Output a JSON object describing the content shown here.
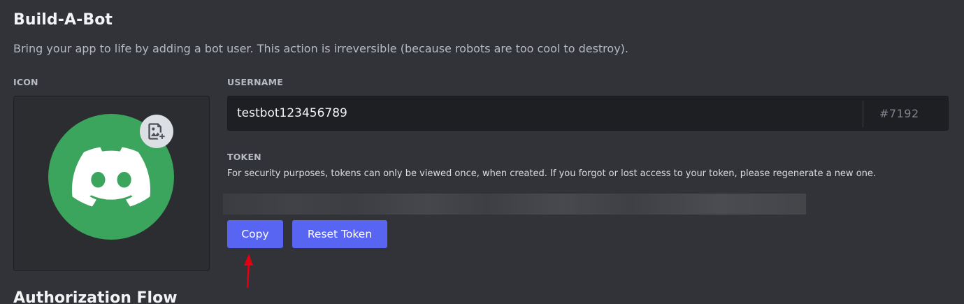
{
  "header": {
    "title": "Build-A-Bot",
    "subtitle": "Bring your app to life by adding a bot user. This action is irreversible (because robots are too cool to destroy)."
  },
  "icon_section": {
    "label": "ICON",
    "avatar_icon": "discord-logo-icon",
    "upload_icon": "image-add-icon",
    "avatar_color": "#3ba55d"
  },
  "username_section": {
    "label": "USERNAME",
    "value": "testbot123456789",
    "discriminator": "#7192"
  },
  "token_section": {
    "label": "TOKEN",
    "description": "For security purposes, tokens can only be viewed once, when created. If you forgot or lost access to your token, please regenerate a new one.",
    "copy_label": "Copy",
    "reset_label": "Reset Token"
  },
  "next_section": {
    "title": "Authorization Flow"
  },
  "colors": {
    "background": "#313338",
    "accent": "#5865f2",
    "annotation_arrow": "#e3000f"
  }
}
